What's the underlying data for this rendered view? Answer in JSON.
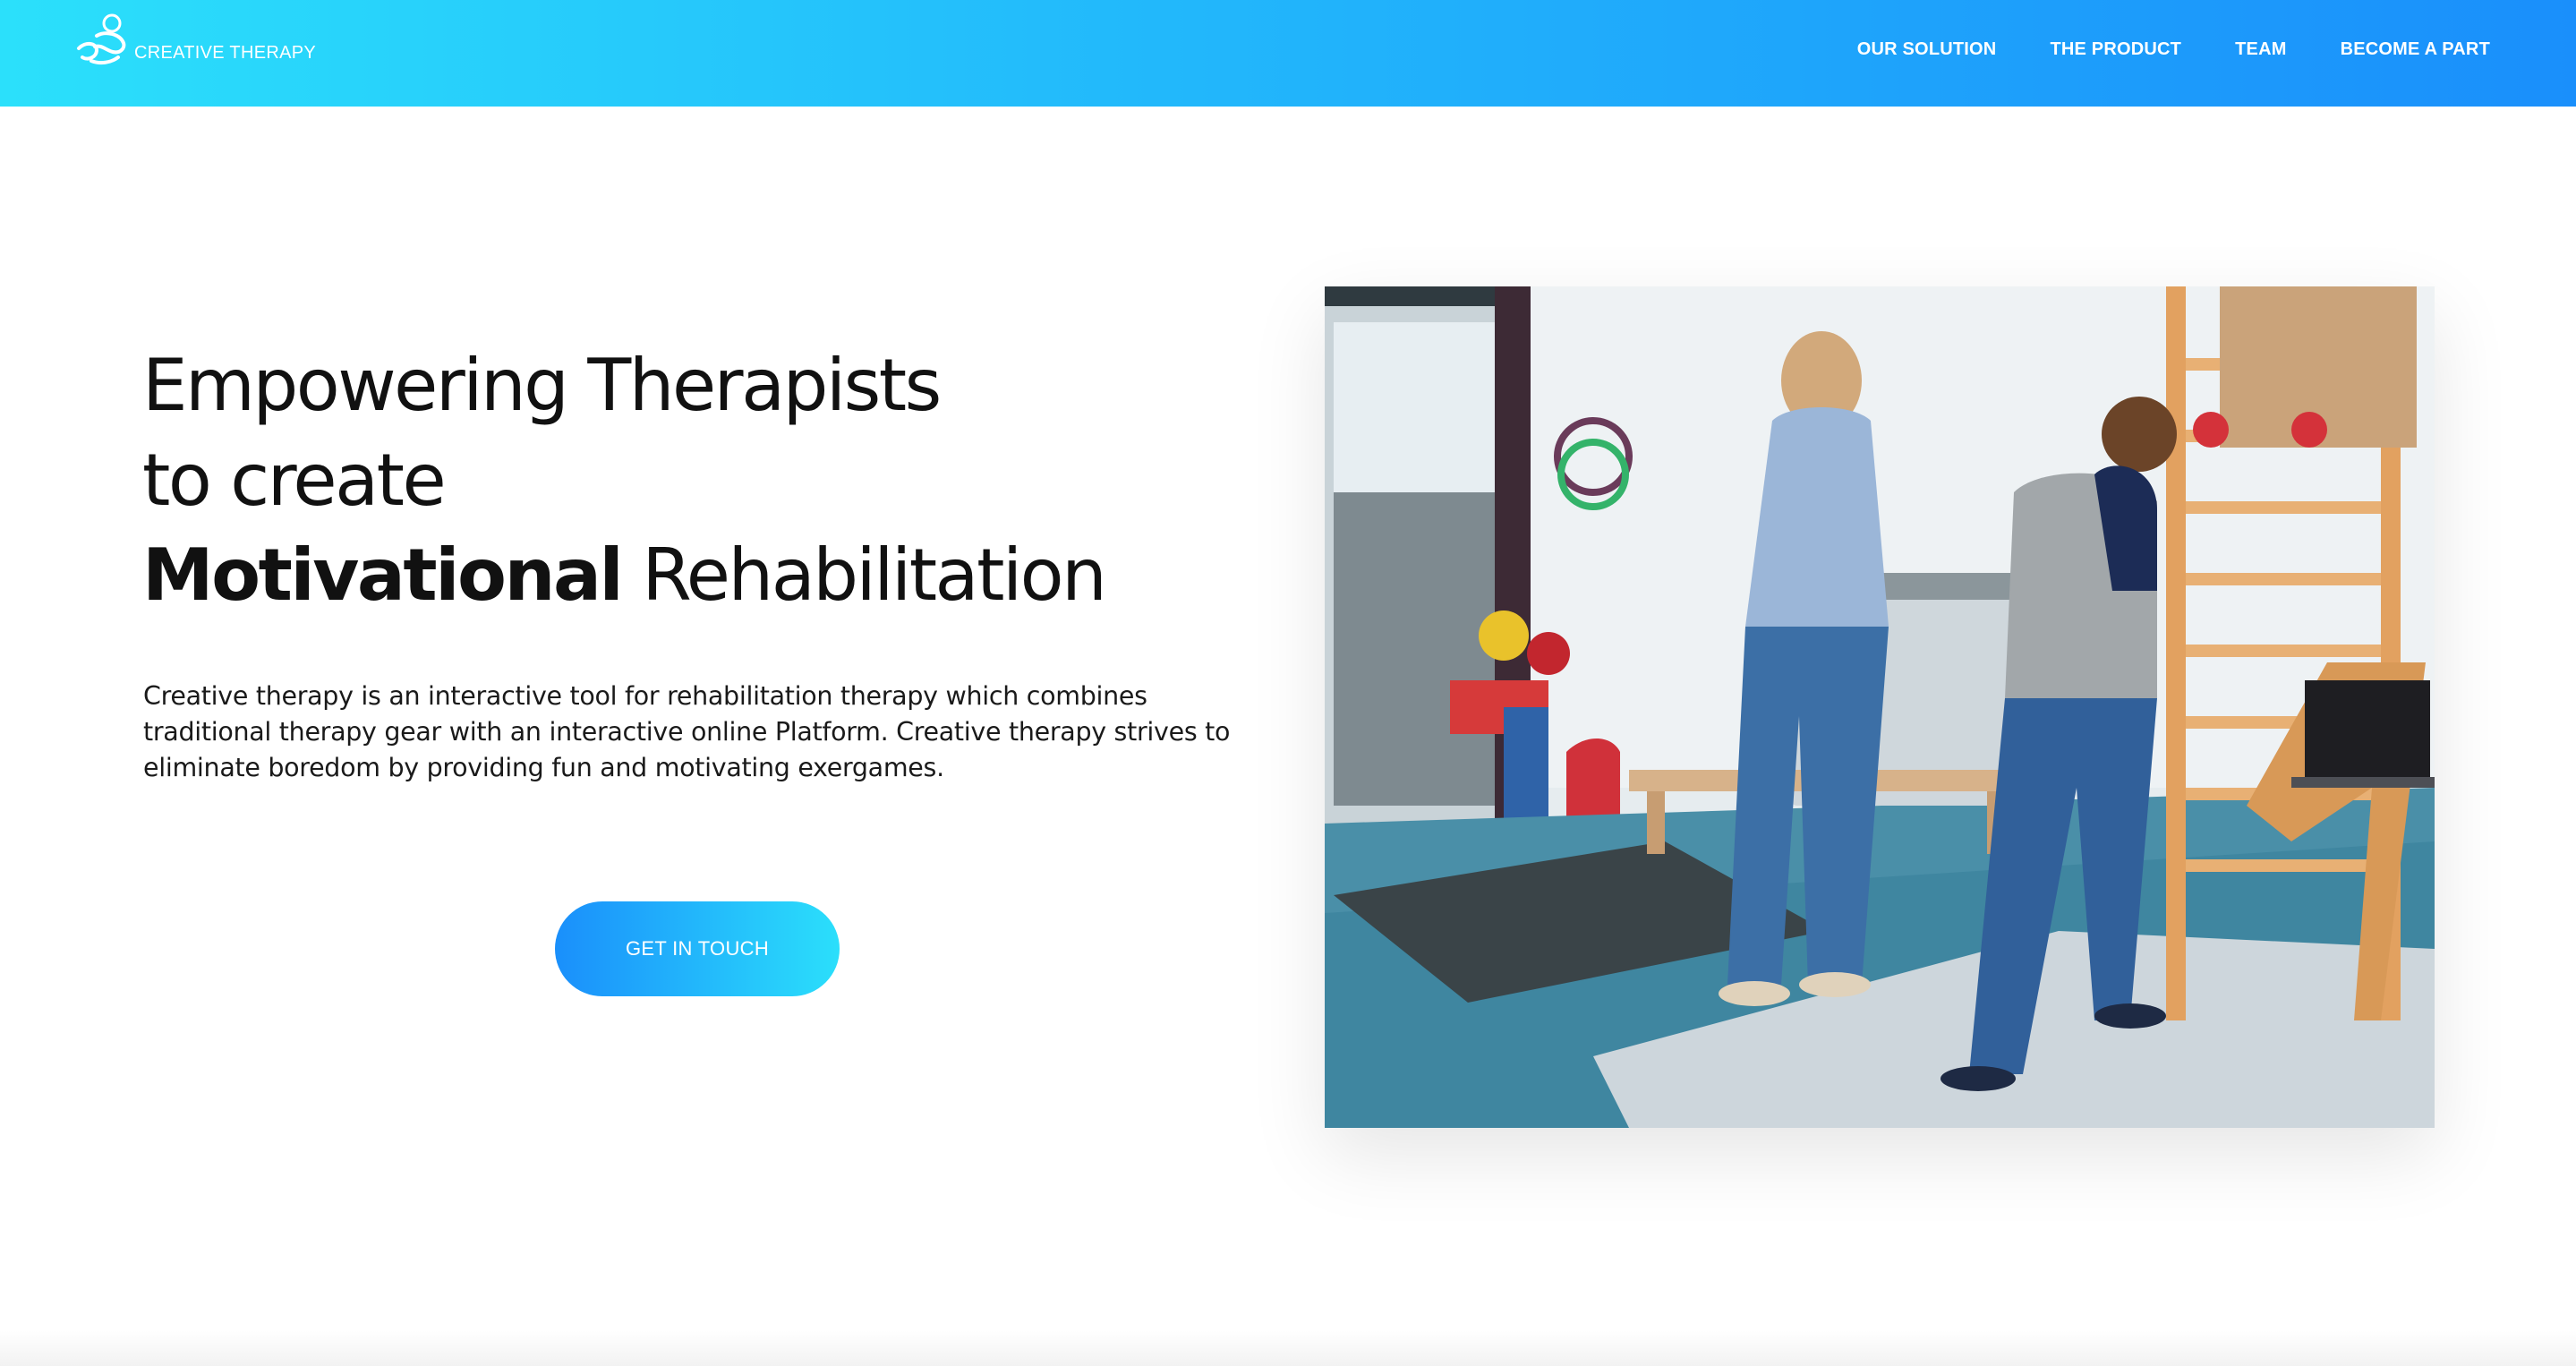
{
  "colors": {
    "header_gradient_start": "#2be0fb",
    "header_gradient_end": "#1a8ffb",
    "cta_gradient_start": "#1a8ffb",
    "cta_gradient_end": "#2bdffb",
    "text": "#111111"
  },
  "brand": {
    "logo_icon": "figure-logo-icon",
    "name": "CREATIVE THERAPY"
  },
  "nav": {
    "items": [
      {
        "label": "OUR SOLUTION"
      },
      {
        "label": "THE PRODUCT"
      },
      {
        "label": "TEAM"
      },
      {
        "label": "BECOME A PART"
      }
    ]
  },
  "hero": {
    "headline_line1": "Empowering Therapists",
    "headline_line2": "to create",
    "headline_strong": "Motivational",
    "headline_rest": " Rehabilitation",
    "description": "Creative therapy is an interactive tool for rehabilitation therapy which combines traditional therapy gear with an interactive online Platform. Creative therapy strives to eliminate boredom by providing fun and motivating exergames.",
    "cta_label": "GET IN TOUCH"
  }
}
